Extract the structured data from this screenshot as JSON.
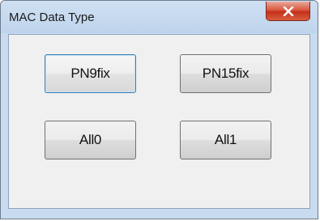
{
  "window": {
    "title": "MAC Data Type",
    "close_icon": "close-x-icon"
  },
  "buttons": [
    {
      "label": "PN9fix"
    },
    {
      "label": "PN15fix"
    },
    {
      "label": "All0"
    },
    {
      "label": "All1"
    }
  ]
}
